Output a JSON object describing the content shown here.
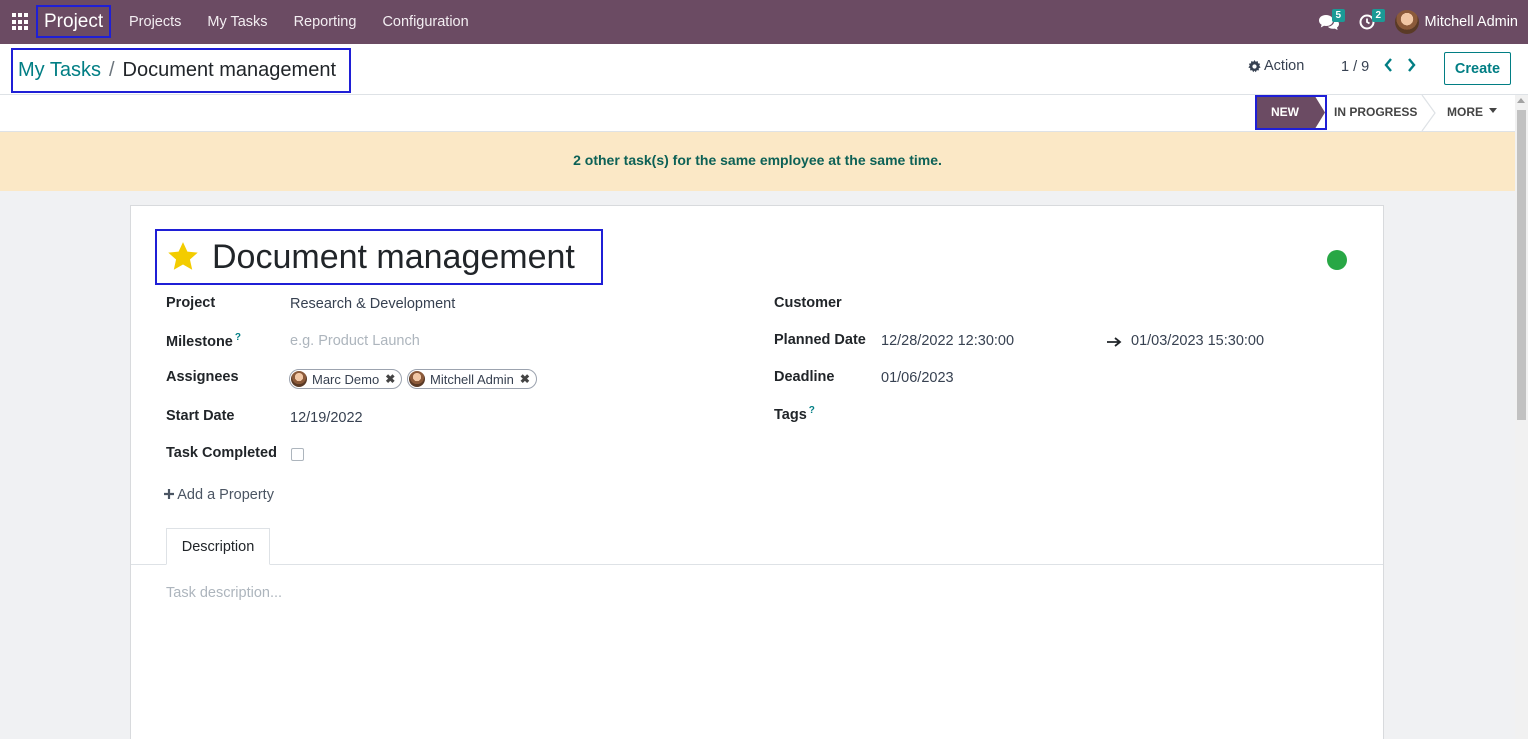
{
  "navbar": {
    "app_name": "Project",
    "menu": [
      "Projects",
      "My Tasks",
      "Reporting",
      "Configuration"
    ],
    "messages_count": "5",
    "activities_count": "2",
    "user_name": "Mitchell Admin"
  },
  "control_panel": {
    "breadcrumb_parent": "My Tasks",
    "breadcrumb_separator": "/",
    "breadcrumb_current": "Document management",
    "action_label": "Action",
    "pager": "1 / 9",
    "create_label": "Create"
  },
  "statusbar": {
    "stages": [
      "NEW",
      "IN PROGRESS"
    ],
    "active_stage": "NEW",
    "more_label": "MORE"
  },
  "alert": {
    "text": "2 other task(s) for the same employee at the same time."
  },
  "form": {
    "title": "Document management",
    "starred": true,
    "kanban_state_color": "#28a745",
    "fields": {
      "project_label": "Project",
      "project_value": "Research & Development",
      "milestone_label": "Milestone",
      "milestone_help": "?",
      "milestone_placeholder": "e.g. Product Launch",
      "assignees_label": "Assignees",
      "assignees": [
        "Marc Demo",
        "Mitchell Admin"
      ],
      "start_date_label": "Start Date",
      "start_date_value": "12/19/2022",
      "task_completed_label": "Task Completed",
      "task_completed": false,
      "customer_label": "Customer",
      "customer_value": "",
      "planned_date_label": "Planned Date",
      "planned_date_start": "12/28/2022 12:30:00",
      "planned_date_end": "01/03/2023 15:30:00",
      "deadline_label": "Deadline",
      "deadline_value": "01/06/2023",
      "tags_label": "Tags",
      "tags_help": "?"
    },
    "add_property_label": "Add a Property",
    "tabs": [
      "Description"
    ],
    "description_placeholder": "Task description..."
  },
  "colors": {
    "navbar": "#6b4b63",
    "accent": "#017e84",
    "alert_bg": "#fbe8c6",
    "highlight_box": "#1f1fd6"
  }
}
